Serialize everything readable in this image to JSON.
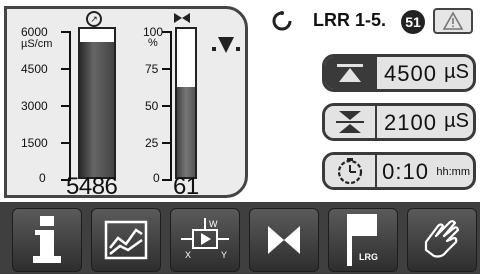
{
  "header": {
    "title": "LRR 1-5.",
    "badge": "51",
    "power_icon": "power-icon",
    "warning_icon": "warning-icon"
  },
  "gauge_conductivity": {
    "scale_top": "6000",
    "unit": "µS/cm",
    "ticks": [
      "4500",
      "3000",
      "1500",
      "0"
    ],
    "value": "5486",
    "fill_fraction": 0.914,
    "icon": "arrow-circle-icon"
  },
  "gauge_percent": {
    "scale_top": "100",
    "unit": "%",
    "ticks": [
      "75",
      "50",
      "25",
      "0"
    ],
    "value": "61",
    "fill_fraction": 0.61,
    "icon": "valve-icon"
  },
  "rows": {
    "upper_limit": {
      "value": "4500",
      "unit": "µS",
      "icon": "upper-limit-icon"
    },
    "lower_limit": {
      "value": "2100",
      "unit": "µS",
      "icon": "lower-limit-icon"
    },
    "timer": {
      "value": "0:10",
      "unit": "hh:mm",
      "icon": "timer-icon"
    }
  },
  "toolbar": {
    "buttons": [
      {
        "icon": "info-icon"
      },
      {
        "icon": "trend-chart-icon"
      },
      {
        "icon": "controller-icon"
      },
      {
        "icon": "valve-icon"
      },
      {
        "icon": "lrg-flag-icon",
        "label": "LRG"
      },
      {
        "icon": "hand-icon"
      }
    ]
  },
  "colors": {
    "panel_bg": "#ececec",
    "toolbar_bg": "#3f3f3f",
    "bar_fill": "#555555",
    "bar_edge": "#2a2a2a"
  }
}
